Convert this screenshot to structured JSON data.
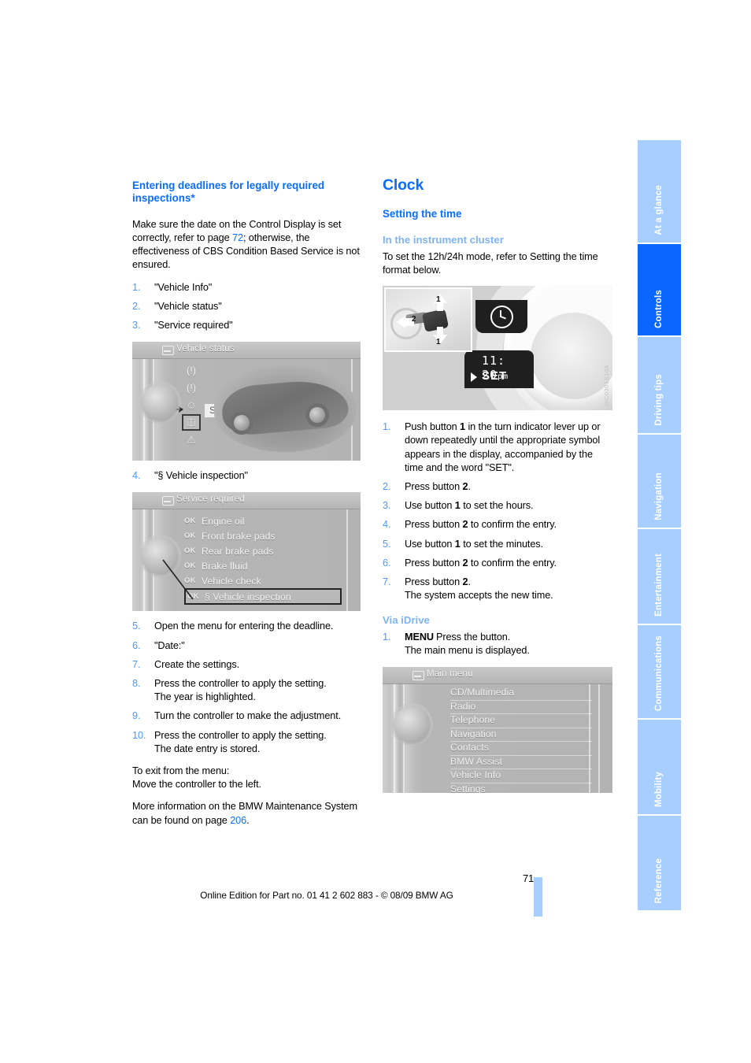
{
  "document": {
    "page_number": "71",
    "footer": "Online Edition for Part no. 01 41 2 602 883 - © 08/09 BMW AG"
  },
  "sidebar": {
    "tabs": [
      {
        "label": "At a glance",
        "active": false
      },
      {
        "label": "Controls",
        "active": true
      },
      {
        "label": "Driving tips",
        "active": false
      },
      {
        "label": "Navigation",
        "active": false
      },
      {
        "label": "Entertainment",
        "active": false
      },
      {
        "label": "Communications",
        "active": false
      },
      {
        "label": "Mobility",
        "active": false
      },
      {
        "label": "Reference",
        "active": false
      }
    ],
    "active_color": "#0a66ff",
    "inactive_color": "#a8ceff"
  },
  "left_column": {
    "heading": "Entering deadlines for legally required inspections*",
    "intro_1": "Make sure the date on the Control Display is set correctly, refer to page ",
    "intro_pageref": "72",
    "intro_2": "; otherwise, the effectiveness of CBS Condition Based Service is not ensured.",
    "steps_a": [
      {
        "num": "1.",
        "text": "\"Vehicle Info\""
      },
      {
        "num": "2.",
        "text": "\"Vehicle status\""
      },
      {
        "num": "3.",
        "text": "\"Service required\""
      }
    ],
    "figure_vehicle_status": {
      "title": "Vehicle status",
      "highlight_label": "Service required",
      "icons": [
        "tire-pressure-icon",
        "tire-pressure-icon",
        "engine-oil-icon",
        "service-required-icon",
        "warning-triangle-icon"
      ]
    },
    "step_4": {
      "num": "4.",
      "text": "\"§ Vehicle inspection\""
    },
    "figure_service_required": {
      "title": "Service required",
      "ok_label": "OK",
      "items": [
        {
          "status": "OK",
          "label": "Engine oil",
          "selected": false
        },
        {
          "status": "OK",
          "label": "Front brake pads",
          "selected": false
        },
        {
          "status": "OK",
          "label": "Rear brake pads",
          "selected": false
        },
        {
          "status": "OK",
          "label": "Brake fluid",
          "selected": false
        },
        {
          "status": "OK",
          "label": "Vehicle check",
          "selected": false
        },
        {
          "status": "OK",
          "label": "§ Vehicle inspection",
          "selected": true
        }
      ]
    },
    "steps_b": [
      {
        "num": "5.",
        "text": "Open the menu for entering the deadline."
      },
      {
        "num": "6.",
        "text": "\"Date:\""
      },
      {
        "num": "7.",
        "text": "Create the settings."
      },
      {
        "num": "8.",
        "text": "Press the controller to apply the setting.\nThe year is highlighted."
      },
      {
        "num": "9.",
        "text": "Turn the controller to make the adjustment."
      },
      {
        "num": "10.",
        "text": "Press the controller to apply the setting.\nThe date entry is stored."
      }
    ],
    "exit_note": "To exit from the menu:\nMove the controller to the left.",
    "more_info_1": "More information on the BMW Maintenance System can be found on page ",
    "more_info_pageref": "206",
    "more_info_2": "."
  },
  "right_column": {
    "chapter_title": "Clock",
    "section_title": "Setting the time",
    "subsection_title": "In the instrument cluster",
    "intro": "To set the 12h/24h mode, refer to Setting the time format below.",
    "figure_cluster": {
      "time": "11: 20",
      "ampm": "pm",
      "set_label": "SET",
      "callout_1a": "1",
      "callout_1b": "1",
      "callout_2": "2",
      "watermark": "WC0301S10A"
    },
    "steps": [
      {
        "num": "1.",
        "parts": [
          "Push button ",
          "1",
          " in the turn indicator lever up or down repeatedly until the appropriate symbol appears in the display, accompanied by the time and the word \"SET\"."
        ]
      },
      {
        "num": "2.",
        "parts": [
          "Press button ",
          "2",
          "."
        ]
      },
      {
        "num": "3.",
        "parts": [
          "Use button ",
          "1",
          " to set the hours."
        ]
      },
      {
        "num": "4.",
        "parts": [
          "Press button ",
          "2",
          " to confirm the entry."
        ]
      },
      {
        "num": "5.",
        "parts": [
          "Use button ",
          "1",
          " to set the minutes."
        ]
      },
      {
        "num": "6.",
        "parts": [
          "Press button ",
          "2",
          " to confirm the entry."
        ]
      },
      {
        "num": "7.",
        "parts": [
          "Press button ",
          "2",
          ".\nThe system accepts the new time."
        ]
      }
    ],
    "idrive_title": "Via iDrive",
    "idrive_step": {
      "num": "1.",
      "bold": "MENU",
      "text": "Press the button.\nThe main menu is displayed."
    },
    "figure_main_menu": {
      "title": "Main menu",
      "items": [
        "CD/Multimedia",
        "Radio",
        "Telephone",
        "Navigation",
        "Contacts",
        "BMW Assist",
        "Vehicle Info",
        "Settings"
      ]
    }
  }
}
